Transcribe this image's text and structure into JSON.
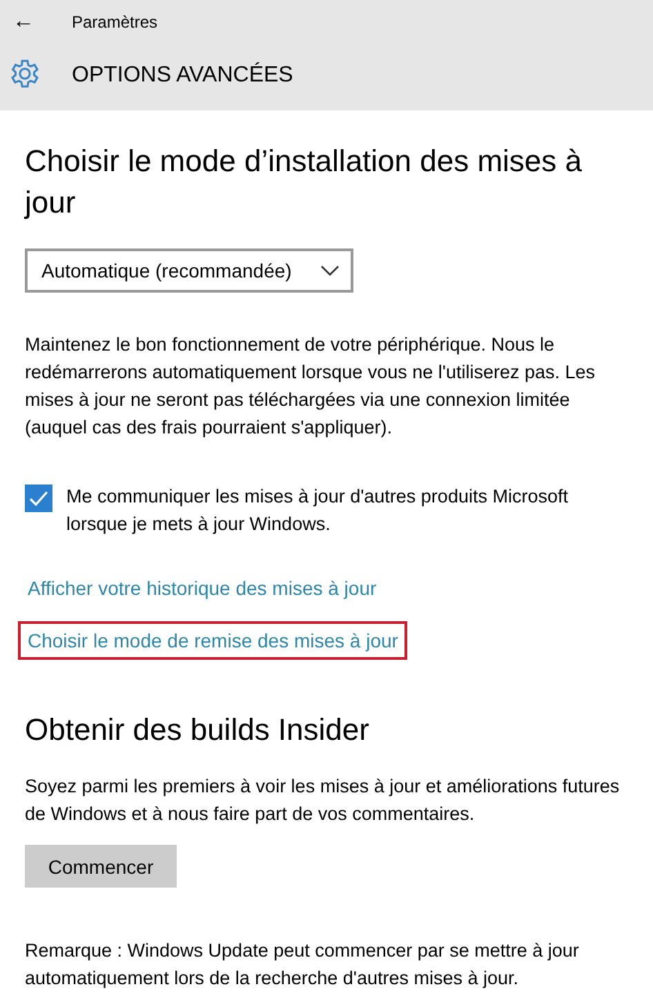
{
  "header": {
    "back": "←",
    "title": "Paramètres",
    "page_title": "OPTIONS AVANCÉES"
  },
  "install": {
    "heading": "Choisir le mode d’installation des mises à jour",
    "dropdown": {
      "value": "Automatique (recommandée)"
    },
    "description": "Maintenez le bon fonctionnement de votre périphérique. Nous le redémarrerons automatiquement lorsque vous ne l'utiliserez pas. Les mises à jour ne seront pas téléchargées via une connexion limitée (auquel cas des frais pourraient s'appliquer).",
    "checkbox": {
      "label": "Me communiquer les mises à jour d'autres produits Microsoft lorsque je mets à jour Windows.",
      "checked": true
    },
    "links": [
      {
        "label": "Afficher votre historique des mises à jour",
        "highlighted": false
      },
      {
        "label": "Choisir le mode de remise des mises à jour",
        "highlighted": true
      }
    ]
  },
  "insider": {
    "heading": "Obtenir des builds Insider",
    "description": "Soyez parmi les premiers à voir les mises à jour et améliorations futures de Windows et à nous faire part de vos commentaires.",
    "button": "Commencer"
  },
  "note": "Remarque : Windows Update peut commencer par se mettre à jour automatiquement lors de la recherche d'autres mises à jour."
}
